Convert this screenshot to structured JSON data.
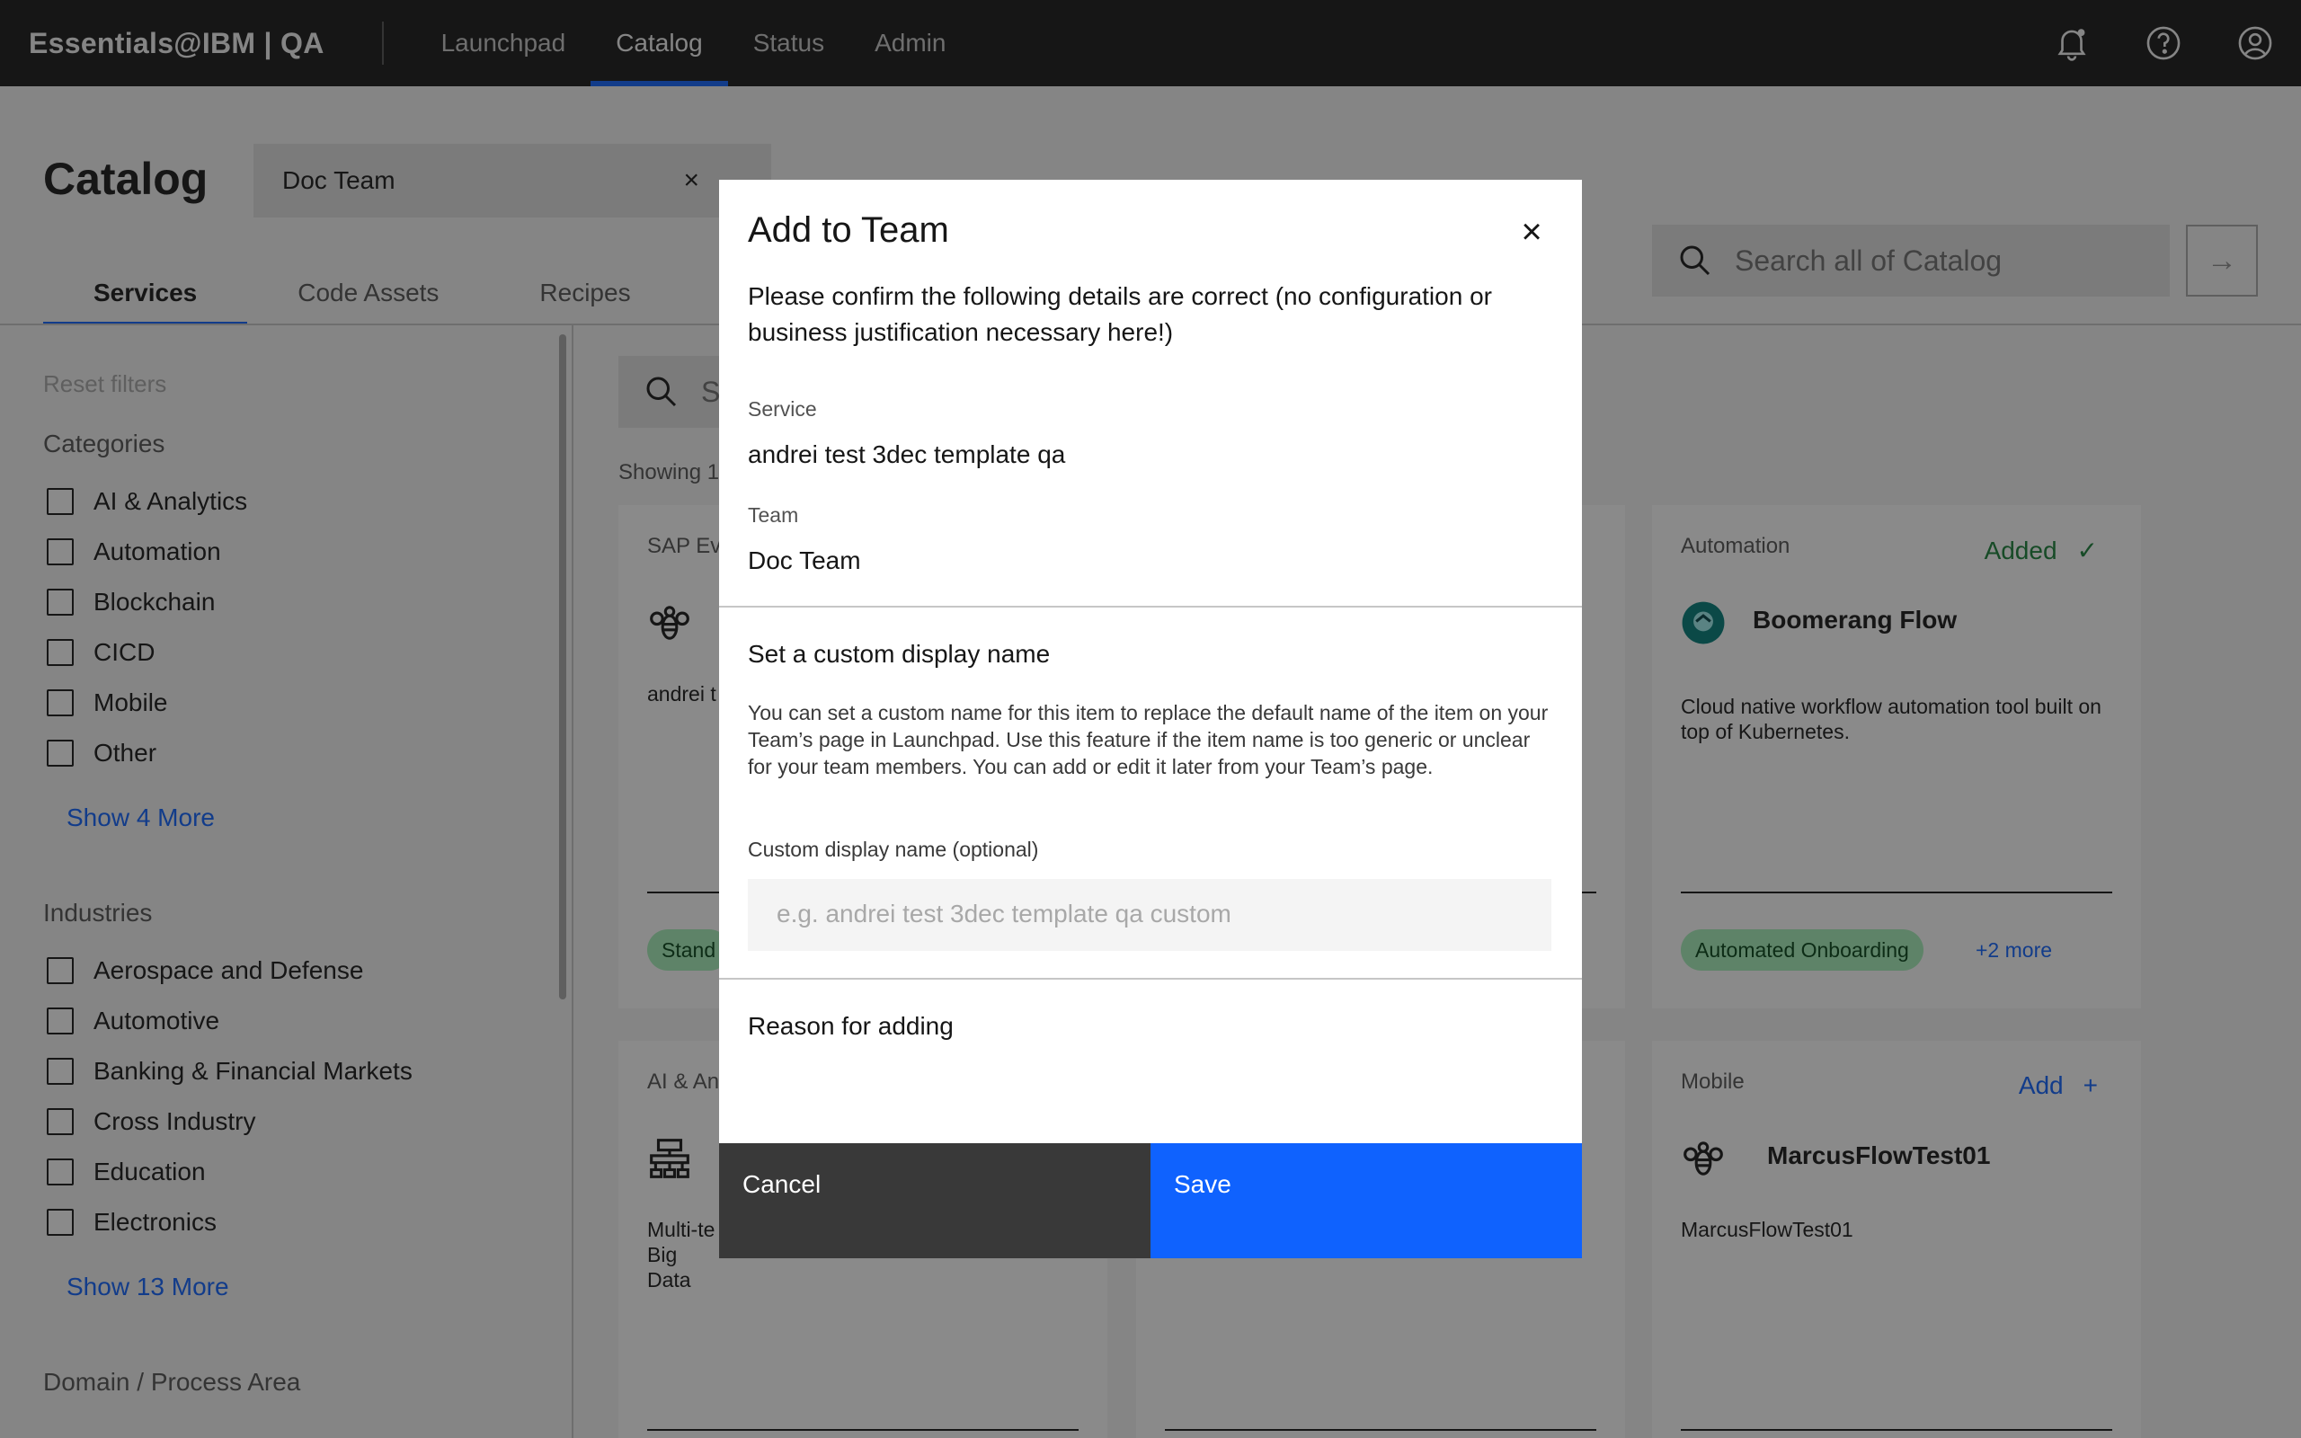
{
  "header": {
    "brand": "Essentials@IBM | QA",
    "nav": [
      {
        "label": "Launchpad"
      },
      {
        "label": "Catalog"
      },
      {
        "label": "Status"
      },
      {
        "label": "Admin"
      }
    ],
    "icons": [
      "notification-icon",
      "help-icon",
      "user-avatar-icon"
    ]
  },
  "catalog": {
    "title": "Catalog",
    "team_select": "Doc Team",
    "tabs": [
      {
        "label": "Services"
      },
      {
        "label": "Code Assets"
      },
      {
        "label": "Recipes"
      }
    ],
    "search_placeholder": "Search all of Catalog",
    "inner_search_text": "S",
    "showing_text": "Showing 1"
  },
  "sidebar": {
    "reset": "Reset filters",
    "categories": {
      "title": "Categories",
      "items": [
        "AI & Analytics",
        "Automation",
        "Blockchain",
        "CICD",
        "Mobile",
        "Other"
      ],
      "show_more": "Show 4 More"
    },
    "industries": {
      "title": "Industries",
      "items": [
        "Aerospace and Defense",
        "Automotive",
        "Banking & Financial Markets",
        "Cross Industry",
        "Education",
        "Electronics"
      ],
      "show_more": "Show 13 More"
    },
    "domain": {
      "title": "Domain / Process Area"
    }
  },
  "cards": [
    {
      "category": "SAP Eve",
      "desc": "andrei t",
      "tag": "Stand"
    },
    {
      "category": "Automation",
      "action": "Added",
      "name": "Boomerang Flow",
      "desc": "Cloud native workflow automation tool built on top of Kubernetes.",
      "tag": "Automated Onboarding",
      "more": "+2 more"
    },
    {
      "category": "AI & An",
      "desc": "Multi-te Big Data"
    },
    {
      "category": "Mobile",
      "action": "Add",
      "name": "MarcusFlowTest01",
      "desc": "MarcusFlowTest01"
    }
  ],
  "modal": {
    "title": "Add to Team",
    "intro": "Please confirm the following details are correct (no configuration or business justification necessary here!)",
    "service_label": "Service",
    "service_value": "andrei test 3dec template qa",
    "team_label": "Team",
    "team_value": "Doc Team",
    "custom_title": "Set a custom display name",
    "custom_help": "You can set a custom name for this item to replace the default name of the item on your Team’s page in Launchpad. Use this feature if the item name is too generic or unclear for your team members. You can add or edit it later from your Team’s page.",
    "custom_label": "Custom display name (optional)",
    "custom_placeholder": "e.g. andrei test 3dec template qa custom",
    "custom_value": "",
    "reason_title": "Reason for adding",
    "cancel": "Cancel",
    "save": "Save"
  },
  "colors": {
    "topbar": "#161616",
    "primary": "#0f62fe",
    "secondary_button": "#393939",
    "success": "#198038",
    "tag_bg": "#a7f0ba"
  }
}
